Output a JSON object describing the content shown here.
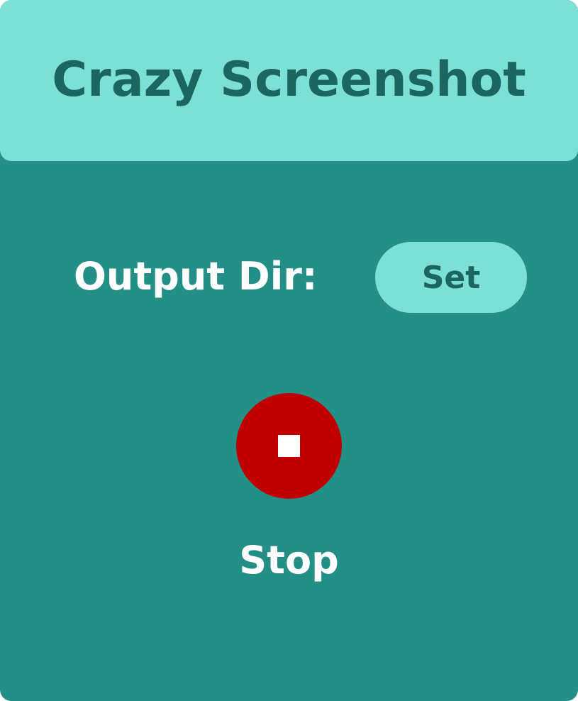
{
  "header": {
    "title": "Crazy Screenshot"
  },
  "settings": {
    "output_dir_label": "Output Dir:",
    "set_label": "Set"
  },
  "recording": {
    "stop_label": "Stop",
    "stop_icon": "stop-square-icon"
  },
  "colors": {
    "background": "#248f87",
    "accent": "#7de0d6",
    "accent_text": "#1c6660",
    "stop_button": "#c00000",
    "text": "#ffffff"
  }
}
